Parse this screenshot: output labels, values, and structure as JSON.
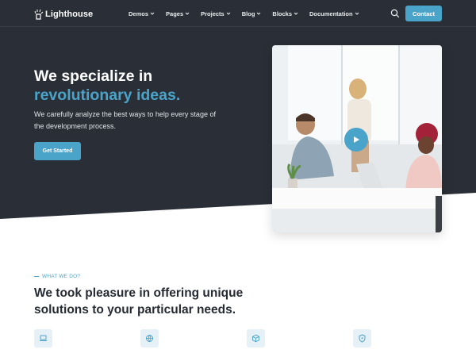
{
  "brand": {
    "name": "Lighthouse",
    "accent": "#4aa3c8",
    "dark": "#2a2f37"
  },
  "nav": {
    "items": [
      {
        "label": "Demos"
      },
      {
        "label": "Pages"
      },
      {
        "label": "Projects"
      },
      {
        "label": "Blog"
      },
      {
        "label": "Blocks"
      },
      {
        "label": "Documentation"
      }
    ],
    "contact_label": "Contact"
  },
  "hero": {
    "title_line1": "We specialize in",
    "title_line2": "revolutionary ideas.",
    "subtitle": "We carefully analyze the best ways to help every stage of the development process.",
    "cta_label": "Get Started"
  },
  "section": {
    "eyebrow": "WHAT WE DO?",
    "title": "We took pleasure in offering unique solutions to your particular needs."
  },
  "features": [
    {
      "icon": "laptop-icon"
    },
    {
      "icon": "globe-icon"
    },
    {
      "icon": "cube-icon"
    },
    {
      "icon": "shield-icon"
    }
  ]
}
